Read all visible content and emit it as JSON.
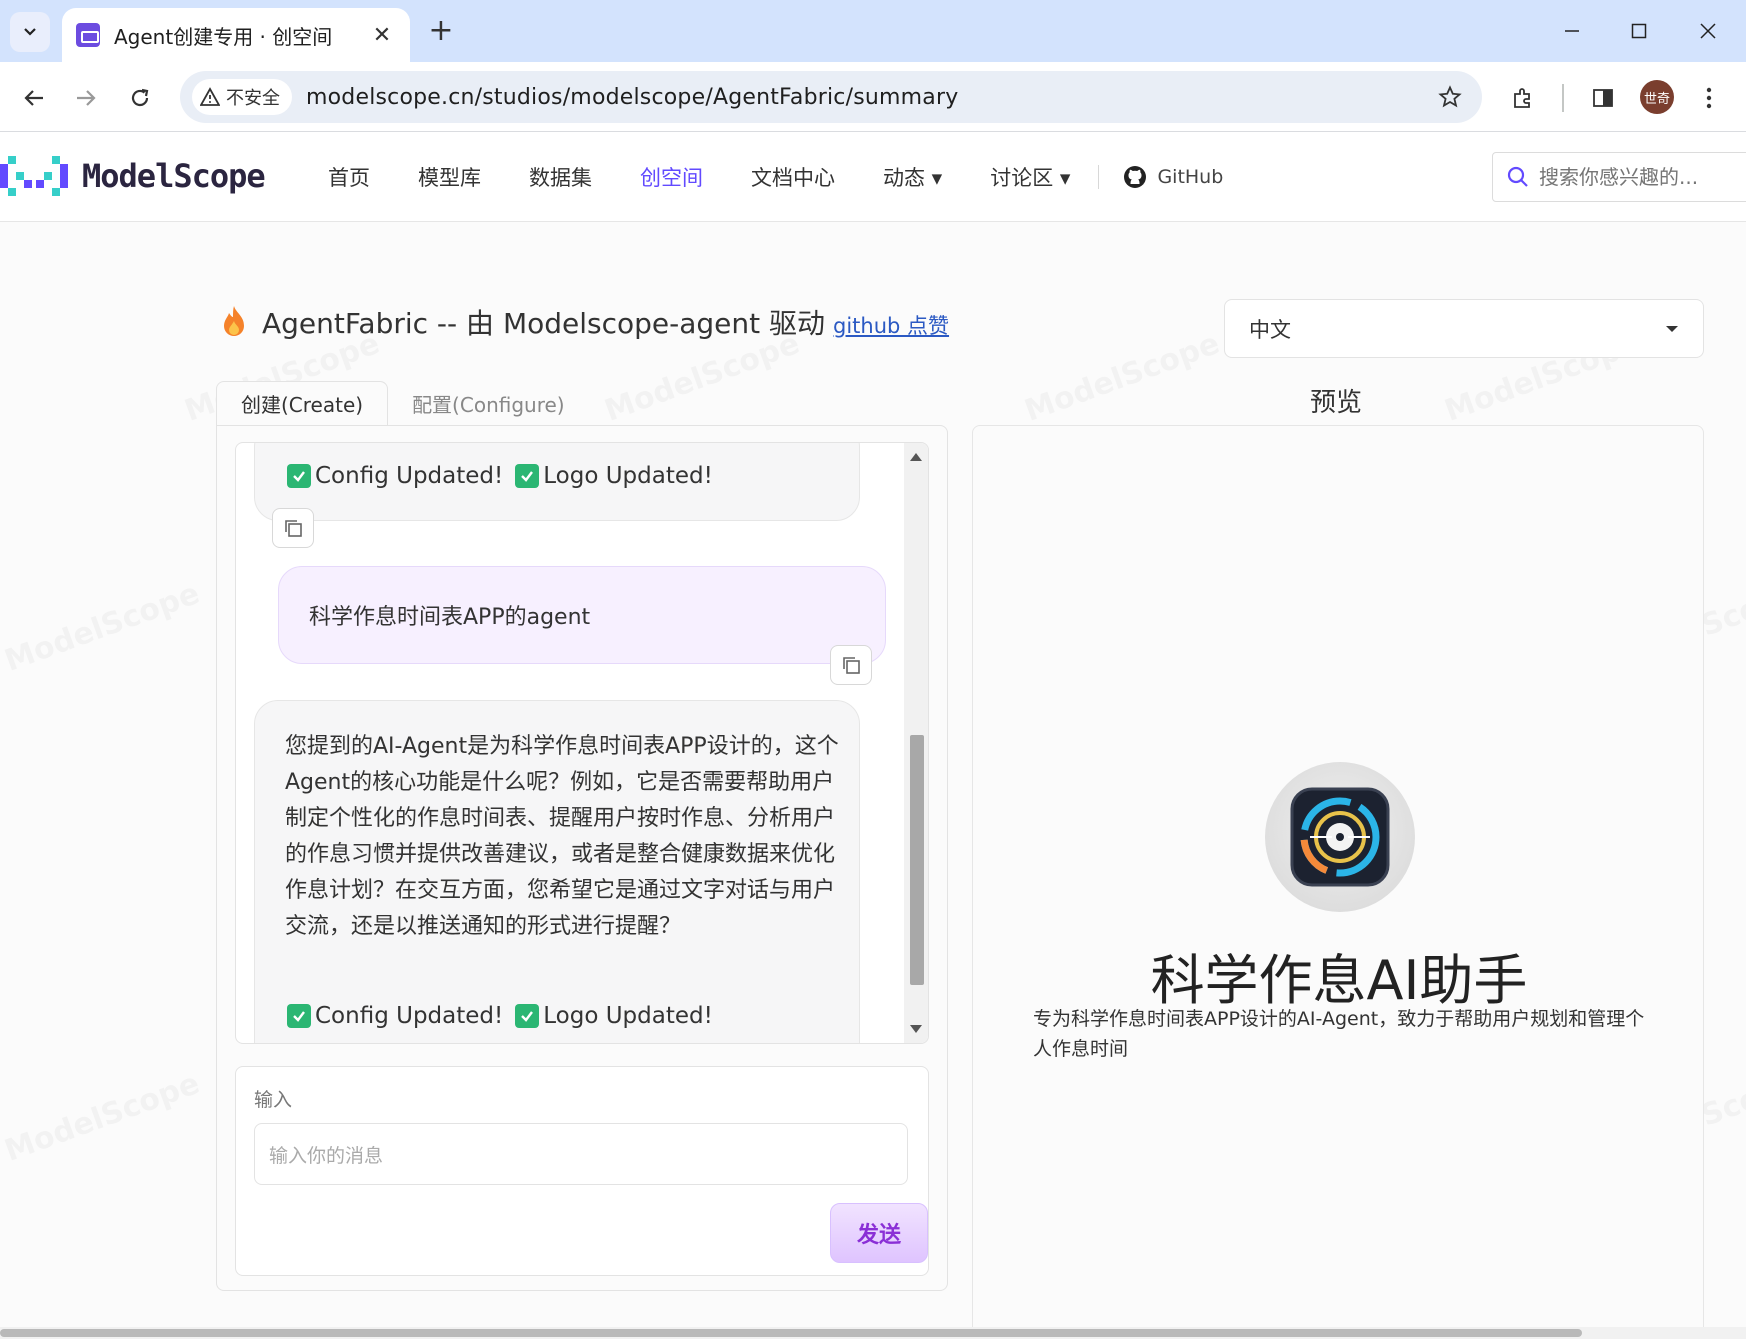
{
  "browser": {
    "tab_title": "Agent创建专用 · 创空间",
    "security_label": "不安全",
    "url": "modelscope.cn/studios/modelscope/AgentFabric/summary",
    "avatar_text": "世奇"
  },
  "site": {
    "logo_text": "ModelScope",
    "nav": [
      "首页",
      "模型库",
      "数据集",
      "创空间",
      "文档中心",
      "动态 ▾",
      "讨论区 ▾"
    ],
    "github_label": "GitHub",
    "search_placeholder": "搜索你感兴趣的...",
    "watermark": "ModelScope"
  },
  "page": {
    "title": "AgentFabric -- 由 Modelscope-agent 驱动",
    "title_link": "github 点赞",
    "language": "中文"
  },
  "tabs": {
    "create": "创建(Create)",
    "configure": "配置(Configure)"
  },
  "chat": {
    "status_config": "Config Updated!",
    "status_logo": "Logo Updated!",
    "user_message": "科学作息时间表APP的agent",
    "bot_message": "您提到的AI-Agent是为科学作息时间表APP设计的，这个Agent的核心功能是什么呢？例如，它是否需要帮助用户制定个性化的作息时间表、提醒用户按时作息、分析用户的作息习惯并提供改善建议，或者是整合健康数据来优化作息计划？在交互方面，您希望它是通过文字对话与用户交流，还是以推送通知的形式进行提醒？"
  },
  "input": {
    "label": "输入",
    "placeholder": "输入你的消息",
    "send_label": "发送"
  },
  "preview": {
    "title": "预览",
    "app_name": "科学作息AI助手",
    "app_desc": "专为科学作息时间表APP设计的AI-Agent，致力于帮助用户规划和管理个人作息时间"
  },
  "colors": {
    "accent": "#624aff",
    "send_text": "#8a2fd6",
    "check_green": "#2bb673"
  }
}
